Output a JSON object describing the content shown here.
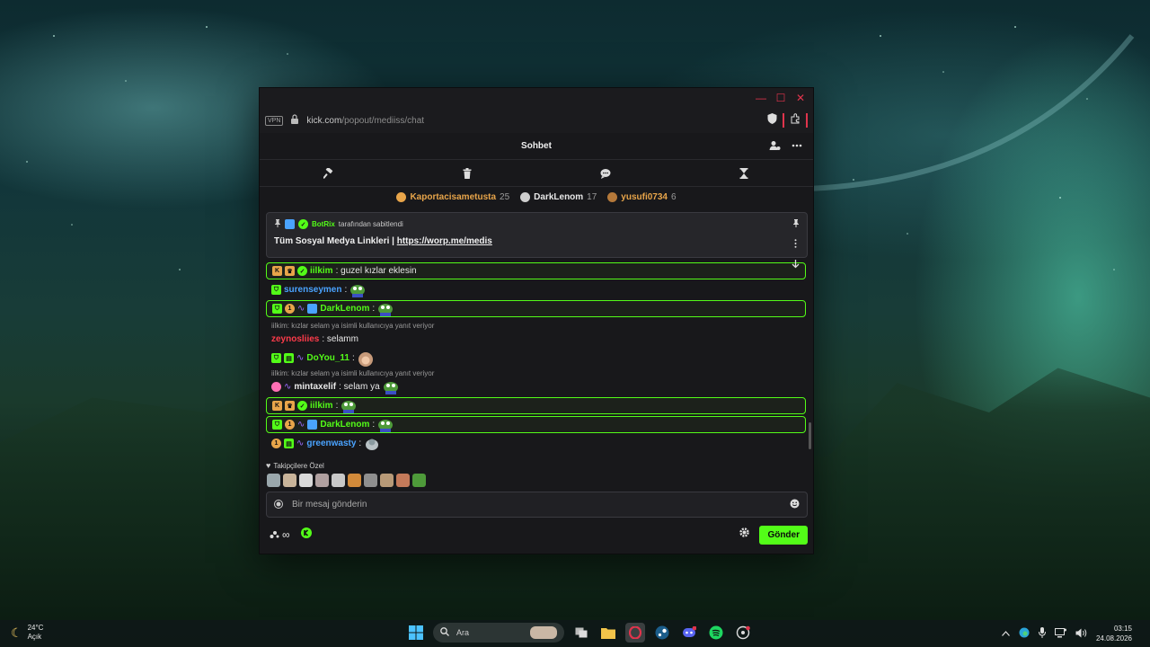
{
  "window": {
    "controls": {
      "min": "—",
      "max": "☐",
      "close": "✕"
    },
    "vpn_label": "VPN",
    "url_host": "kick.com",
    "url_path": "/popout/mediiss/chat"
  },
  "header": {
    "title": "Sohbet"
  },
  "leaderboard": [
    {
      "name": "Kaportacisametusta",
      "count": "25",
      "color": "#e8a54a"
    },
    {
      "name": "DarkLenom",
      "count": "17",
      "color": "#d8d8d8"
    },
    {
      "name": "yusufi0734",
      "count": "6",
      "color": "#e8a54a"
    }
  ],
  "pinned": {
    "author": "BotRix",
    "label": "tarafından sabitlendi",
    "text_prefix": "Tüm Sosyal Medya Linkleri |",
    "link": "https://worp.me/medis"
  },
  "messages": [
    {
      "user": "iilkim",
      "text": ": guzel kızlar eklesin",
      "user_color": "#53fc18"
    },
    {
      "user": "surenseymen",
      "text": ":",
      "user_color": "#4aa3ff"
    },
    {
      "user": "DarkLenom",
      "text": ":",
      "user_color": "#53fc18"
    },
    {
      "reply": "iilkim: kızlar selam ya isimli kullanıcıya yanıt veriyor"
    },
    {
      "user": "zeynosliies",
      "text": ": selamm",
      "user_color": "#ff3b4a"
    },
    {
      "user": "DoYou_11",
      "text": ":",
      "user_color": "#53fc18"
    },
    {
      "reply": "iilkim: kızlar selam ya isimli kullanıcıya yanıt veriyor"
    },
    {
      "user": "mintaxelif",
      "text": ": selam ya",
      "user_color": "#e8e8e8"
    },
    {
      "user": "iilkim",
      "text": ":",
      "user_color": "#53fc18"
    },
    {
      "user": "DarkLenom",
      "text": ":",
      "user_color": "#53fc18"
    },
    {
      "user": "greenwasty",
      "text": ":",
      "user_color": "#4aa3ff"
    }
  ],
  "follower_emotes_label": "Takipçilere Özel",
  "input": {
    "placeholder": "Bir mesaj gönderin"
  },
  "footer": {
    "infinity": "∞",
    "send_label": "Gönder"
  },
  "taskbar": {
    "temp": "24°C",
    "weather": "Açık",
    "search_label": "Ara",
    "time": "03:15",
    "date": "24.08.2026"
  },
  "colors": {
    "accent": "#53fc18",
    "close": "#e0344c"
  }
}
